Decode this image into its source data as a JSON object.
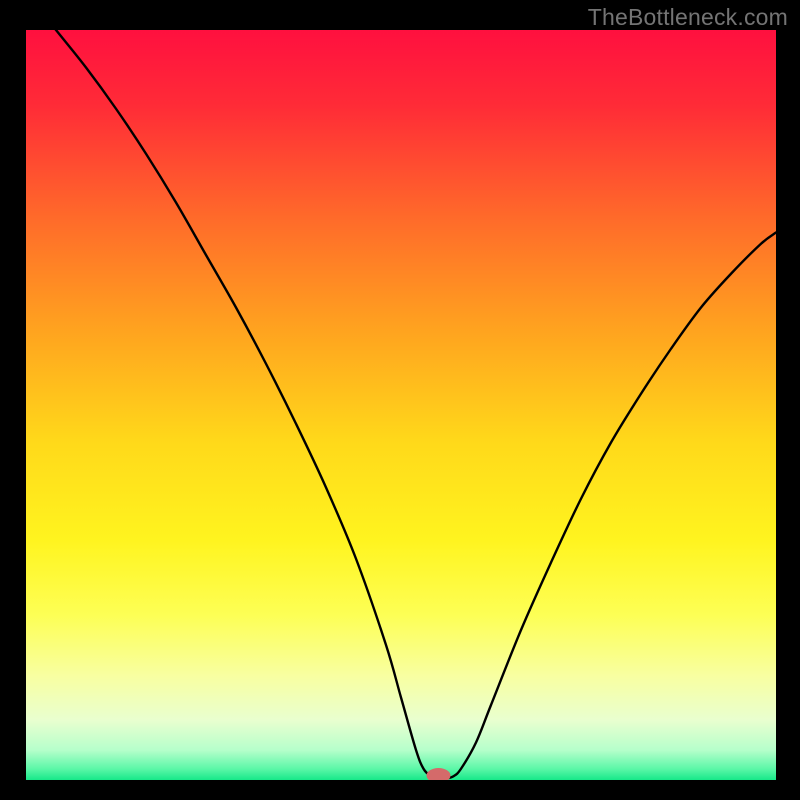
{
  "watermark": "TheBottleneck.com",
  "chart_data": {
    "type": "line",
    "title": "",
    "xlabel": "",
    "ylabel": "",
    "xlim": [
      0,
      100
    ],
    "ylim": [
      0,
      100
    ],
    "grid": false,
    "legend": false,
    "gradient_stops": [
      {
        "offset": 0.0,
        "color": "#ff103f"
      },
      {
        "offset": 0.1,
        "color": "#ff2b37"
      },
      {
        "offset": 0.25,
        "color": "#ff6a2a"
      },
      {
        "offset": 0.4,
        "color": "#ffa31f"
      },
      {
        "offset": 0.55,
        "color": "#ffd91a"
      },
      {
        "offset": 0.68,
        "color": "#fff41f"
      },
      {
        "offset": 0.78,
        "color": "#fdff55"
      },
      {
        "offset": 0.86,
        "color": "#f8ffa0"
      },
      {
        "offset": 0.92,
        "color": "#e9ffcf"
      },
      {
        "offset": 0.96,
        "color": "#b6ffcb"
      },
      {
        "offset": 0.985,
        "color": "#5cf7a8"
      },
      {
        "offset": 1.0,
        "color": "#17e889"
      }
    ],
    "series": [
      {
        "name": "bottleneck-curve",
        "stroke": "#000000",
        "x": [
          0,
          4,
          8,
          12,
          16,
          20,
          24,
          28,
          32,
          36,
          40,
          44,
          48,
          50,
          52,
          53,
          54,
          55,
          56,
          57,
          58,
          60,
          62,
          66,
          70,
          74,
          78,
          82,
          86,
          90,
          94,
          98,
          100
        ],
        "y": [
          105,
          100,
          95,
          89.5,
          83.5,
          77,
          70,
          63,
          55.5,
          47.5,
          39,
          29.5,
          18,
          11,
          4,
          1.5,
          0.5,
          0.2,
          0.2,
          0.5,
          1.5,
          5,
          10,
          20,
          29,
          37.5,
          45,
          51.5,
          57.5,
          63,
          67.5,
          71.5,
          73
        ]
      }
    ],
    "marker": {
      "name": "optimal-point",
      "x": 55,
      "y": 0.6,
      "color": "#d46a6a",
      "rx": 1.6,
      "ry": 1.0
    }
  }
}
